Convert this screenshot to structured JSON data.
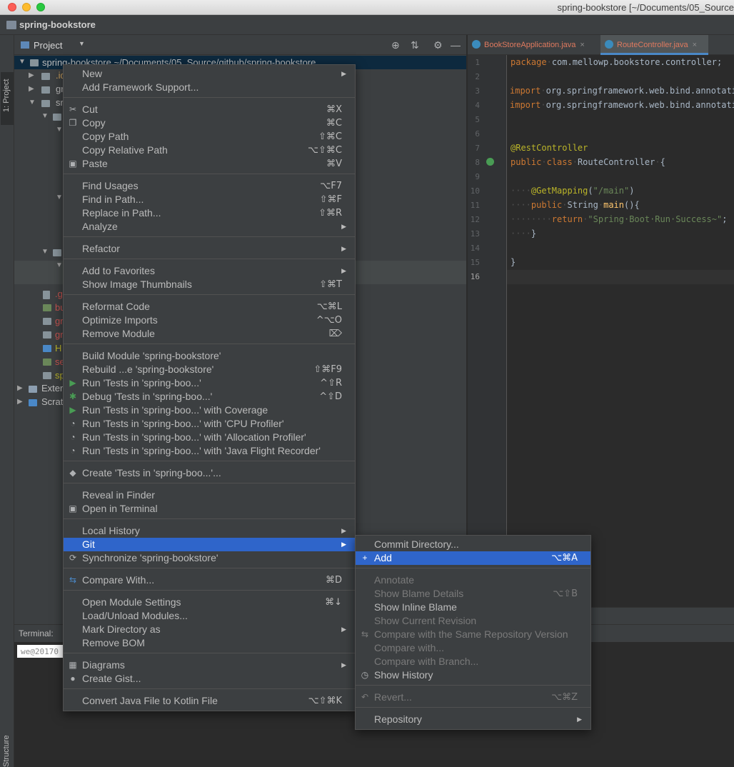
{
  "window": {
    "title": "spring-bookstore [~/Documents/05_Source"
  },
  "navbar": {
    "project": "spring-bookstore"
  },
  "stripe": {
    "project_tab": "1: Project",
    "structure_tab": "Structure"
  },
  "project_panel": {
    "title": "Project",
    "root_label": "spring-bookstore ~/Documents/05_Source/github/spring-bookstore",
    "rows": [
      ".id",
      "gr",
      "sr",
      ".g",
      "bu",
      "gr",
      "gr",
      "H",
      "se",
      "sp",
      "Exter",
      "Scrat"
    ]
  },
  "editor": {
    "tabs": [
      {
        "label": "BookStoreApplication.java"
      },
      {
        "label": "RouteController.java"
      }
    ],
    "line_numbers": [
      "1",
      "2",
      "3",
      "4",
      "5",
      "6",
      "7",
      "8",
      "9",
      "10",
      "11",
      "12",
      "13",
      "14",
      "15",
      "16"
    ]
  },
  "terminal": {
    "title": "Terminal:",
    "tab": "we@20170"
  },
  "context_menu": {
    "items": [
      {
        "label": "New",
        "submenu": true
      },
      {
        "label": "Add Framework Support..."
      },
      {
        "label": "Cut",
        "shortcut": "⌘X",
        "icon": "cut"
      },
      {
        "label": "Copy",
        "shortcut": "⌘C",
        "icon": "copy"
      },
      {
        "label": "Copy Path",
        "shortcut": "⇧⌘C"
      },
      {
        "label": "Copy Relative Path",
        "shortcut": "⌥⇧⌘C"
      },
      {
        "label": "Paste",
        "shortcut": "⌘V",
        "icon": "paste"
      },
      {
        "label": "Find Usages",
        "shortcut": "⌥F7"
      },
      {
        "label": "Find in Path...",
        "shortcut": "⇧⌘F"
      },
      {
        "label": "Replace in Path...",
        "shortcut": "⇧⌘R"
      },
      {
        "label": "Analyze",
        "submenu": true
      },
      {
        "label": "Refactor",
        "submenu": true
      },
      {
        "label": "Add to Favorites",
        "submenu": true
      },
      {
        "label": "Show Image Thumbnails",
        "shortcut": "⇧⌘T"
      },
      {
        "label": "Reformat Code",
        "shortcut": "⌥⌘L"
      },
      {
        "label": "Optimize Imports",
        "shortcut": "^⌥O"
      },
      {
        "label": "Remove Module",
        "shortcut": "⌦"
      },
      {
        "label": "Build Module 'spring-bookstore'"
      },
      {
        "label": "Rebuild ...e 'spring-bookstore'",
        "shortcut": "⇧⌘F9"
      },
      {
        "label": "Run 'Tests in 'spring-boo...'",
        "shortcut": "^⇧R",
        "icon": "run"
      },
      {
        "label": "Debug 'Tests in 'spring-boo...'",
        "shortcut": "^⇧D",
        "icon": "debug"
      },
      {
        "label": "Run 'Tests in 'spring-boo...' with Coverage",
        "icon": "coverage"
      },
      {
        "label": "Run 'Tests in 'spring-boo...' with 'CPU Profiler'",
        "icon": "profiler"
      },
      {
        "label": "Run 'Tests in 'spring-boo...' with 'Allocation Profiler'",
        "icon": "profiler"
      },
      {
        "label": "Run 'Tests in 'spring-boo...' with 'Java Flight Recorder'",
        "icon": "profiler"
      },
      {
        "label": "Create 'Tests in 'spring-boo...'...",
        "icon": "create"
      },
      {
        "label": "Reveal in Finder"
      },
      {
        "label": "Open in Terminal",
        "icon": "terminal"
      },
      {
        "label": "Local History",
        "submenu": true
      },
      {
        "label": "Git",
        "submenu": true,
        "selected": true
      },
      {
        "label": "Synchronize 'spring-bookstore'",
        "icon": "sync"
      },
      {
        "label": "Compare With...",
        "shortcut": "⌘D",
        "icon": "compare"
      },
      {
        "label": "Open Module Settings",
        "shortcut": "⌘↓"
      },
      {
        "label": "Load/Unload Modules..."
      },
      {
        "label": "Mark Directory as",
        "submenu": true
      },
      {
        "label": "Remove BOM"
      },
      {
        "label": "Diagrams",
        "submenu": true,
        "icon": "diagrams"
      },
      {
        "label": "Create Gist...",
        "icon": "github"
      },
      {
        "label": "Convert Java File to Kotlin File",
        "shortcut": "⌥⇧⌘K"
      }
    ]
  },
  "git_submenu": {
    "items": [
      {
        "label": "Commit Directory..."
      },
      {
        "label": "Add",
        "shortcut": "⌥⌘A",
        "icon": "plus",
        "selected": true
      },
      {
        "label": "Annotate",
        "disabled": true
      },
      {
        "label": "Show Blame Details",
        "shortcut": "⌥⇧B",
        "disabled": true
      },
      {
        "label": "Show Inline Blame"
      },
      {
        "label": "Show Current Revision",
        "disabled": true
      },
      {
        "label": "Compare with the Same Repository Version",
        "disabled": true,
        "icon": "compare"
      },
      {
        "label": "Compare with...",
        "disabled": true
      },
      {
        "label": "Compare with Branch...",
        "disabled": true
      },
      {
        "label": "Show History",
        "icon": "clock"
      },
      {
        "label": "Revert...",
        "shortcut": "⌥⌘Z",
        "disabled": true,
        "icon": "revert"
      },
      {
        "label": "Repository",
        "submenu": true
      }
    ]
  }
}
